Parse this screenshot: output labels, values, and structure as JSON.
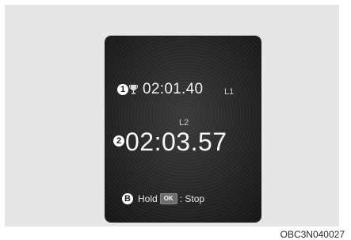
{
  "display": {
    "best_lap": {
      "marker": "1",
      "icon": "trophy-icon",
      "time": "02:01.40",
      "lap_label": "L1"
    },
    "current_lap": {
      "marker": "2",
      "lap_label": "L2",
      "time": "02:03.57"
    },
    "hint": {
      "marker": "B",
      "prefix": "Hold",
      "key_label": "OK",
      "suffix": ": Stop"
    }
  },
  "figure": {
    "code": "OBC3N040027"
  },
  "colors": {
    "panel_background": "#e6e6e6",
    "screen_background": "#262626",
    "text": "#f2f2f2"
  }
}
